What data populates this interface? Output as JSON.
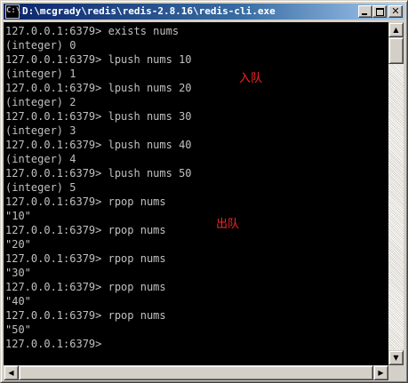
{
  "window": {
    "title": "D:\\mcgrady\\redis\\redis-2.8.16\\redis-cli.exe",
    "icon": "console-app-icon",
    "controls": {
      "minimize_icon": "minimize-icon",
      "maximize_icon": "maximize-icon",
      "close_glyph": "✕"
    }
  },
  "console": {
    "lines": [
      "127.0.0.1:6379> exists nums",
      "(integer) 0",
      "127.0.0.1:6379> lpush nums 10",
      "(integer) 1",
      "127.0.0.1:6379> lpush nums 20",
      "(integer) 2",
      "127.0.0.1:6379> lpush nums 30",
      "(integer) 3",
      "127.0.0.1:6379> lpush nums 40",
      "(integer) 4",
      "127.0.0.1:6379> lpush nums 50",
      "(integer) 5",
      "127.0.0.1:6379> rpop nums",
      "\"10\"",
      "127.0.0.1:6379> rpop nums",
      "\"20\"",
      "127.0.0.1:6379> rpop nums",
      "\"30\"",
      "127.0.0.1:6379> rpop nums",
      "\"40\"",
      "127.0.0.1:6379> rpop nums",
      "\"50\"",
      "127.0.0.1:6379>"
    ],
    "annotations": {
      "enqueue": "入队",
      "dequeue": "出队"
    },
    "colors": {
      "background": "#000000",
      "text": "#c0c0c0",
      "annotation": "#ff2222"
    }
  },
  "scrollbars": {
    "up_arrow": "▲",
    "down_arrow": "▼",
    "left_arrow": "◀",
    "right_arrow": "▶"
  }
}
